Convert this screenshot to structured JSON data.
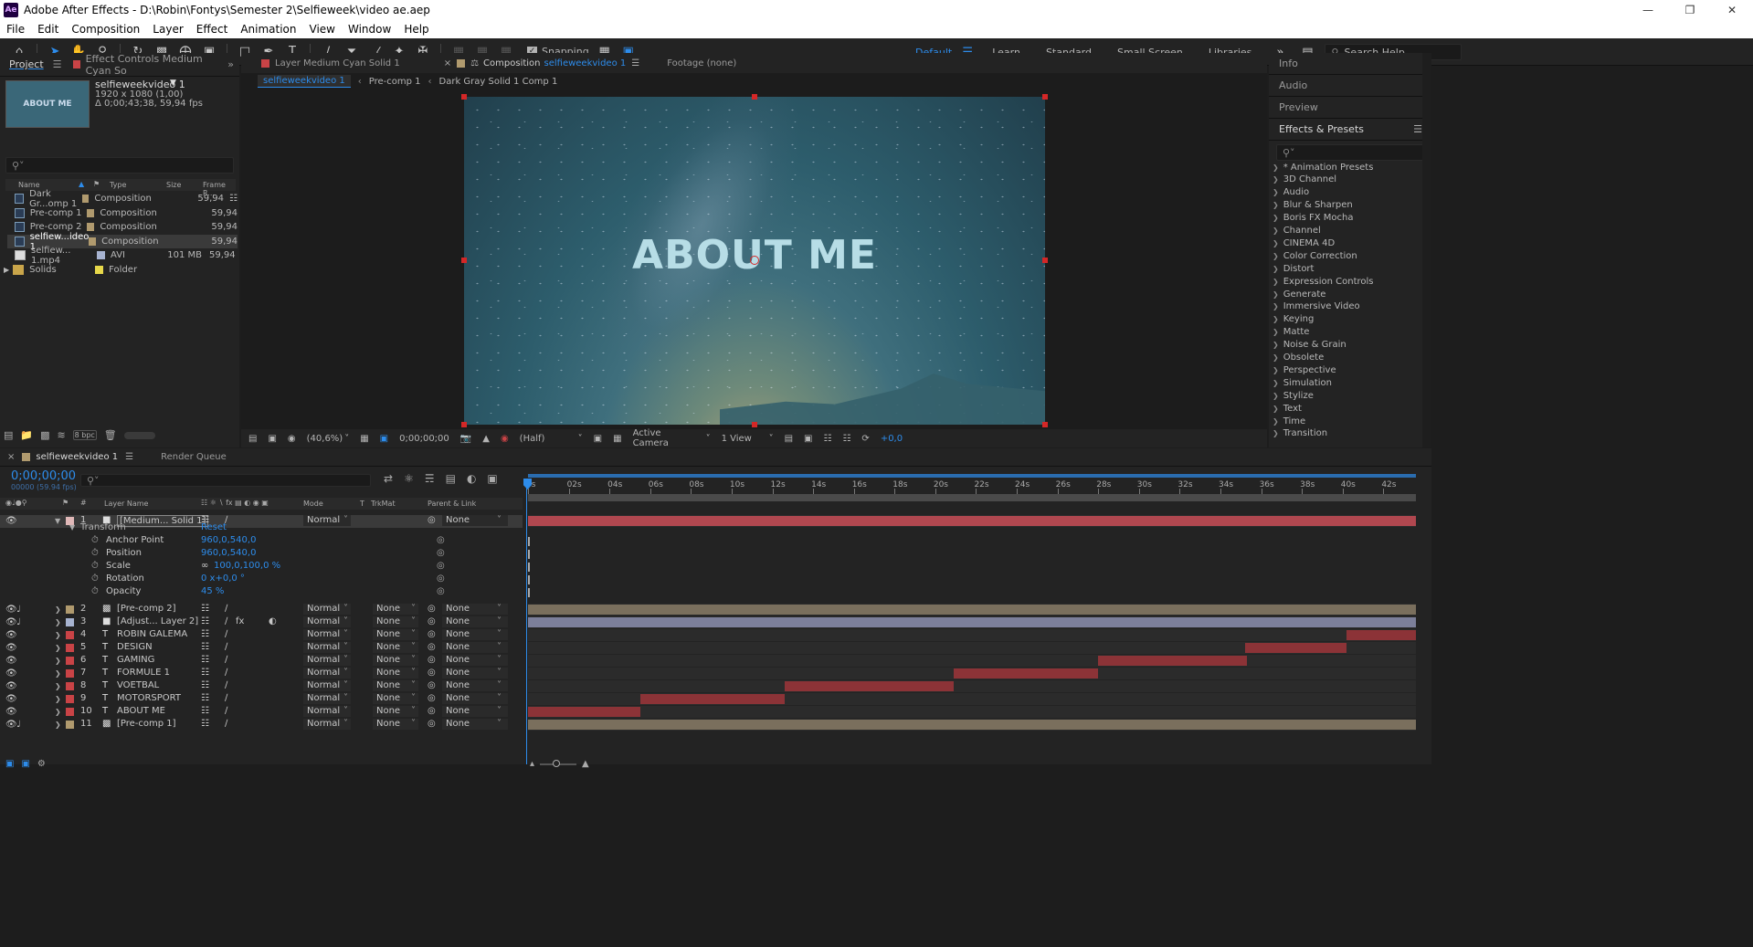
{
  "titlebar": {
    "icon": "Ae",
    "title": "Adobe After Effects - D:\\Robin\\Fontys\\Semester 2\\Selfieweek\\video ae.aep"
  },
  "menu": [
    "File",
    "Edit",
    "Composition",
    "Layer",
    "Effect",
    "Animation",
    "View",
    "Window",
    "Help"
  ],
  "toolbar": {
    "snapping_label": "Snapping",
    "workspaces": [
      "Default",
      "Learn",
      "Standard",
      "Small Screen",
      "Libraries"
    ],
    "active_workspace": "Default",
    "search_help": "Search Help"
  },
  "project": {
    "tab_project": "Project",
    "tab_effect_controls": "Effect Controls Medium Cyan So",
    "comp_name": "selfieweekvideo 1",
    "comp_res": "1920 x 1080 (1,00)",
    "comp_duration": "Δ 0;00;43;38, 59,94 fps",
    "thumb_text": "ABOUT ME",
    "columns": [
      "Name",
      "Type",
      "Size",
      "Frame R..."
    ],
    "items": [
      {
        "name": "Dark Gr...omp 1",
        "type": "Composition",
        "size": "",
        "fps": "59,94",
        "color": "#b09a6e"
      },
      {
        "name": "Pre-comp 1",
        "type": "Composition",
        "size": "",
        "fps": "59,94",
        "color": "#b09a6e"
      },
      {
        "name": "Pre-comp 2",
        "type": "Composition",
        "size": "",
        "fps": "59,94",
        "color": "#b09a6e"
      },
      {
        "name": "selfiew...ideo 1",
        "type": "Composition",
        "size": "",
        "fps": "59,94",
        "color": "#b09a6e"
      },
      {
        "name": "selfiew... 1.mp4",
        "type": "AVI",
        "size": "101 MB",
        "fps": "59,94",
        "color": "#a7b3d0"
      },
      {
        "name": "Solids",
        "type": "Folder",
        "size": "",
        "fps": "",
        "color": "#e7d84a"
      }
    ],
    "bpc": "8 bpc"
  },
  "viewer": {
    "tab_layer": "Layer  Medium Cyan Solid 1",
    "tab_comp_prefix": "Composition",
    "tab_comp_name": "selfieweekvideo 1",
    "tab_footage": "Footage  (none)",
    "breadcrumbs": [
      "selfieweekvideo 1",
      "Pre-comp 1",
      "Dark Gray Solid 1 Comp 1"
    ],
    "canvas_text": "ABOUT ME",
    "zoom": "(40,6%)",
    "timecode": "0;00;00;00",
    "resolution": "(Half)",
    "camera": "Active Camera",
    "views": "1 View",
    "exposure": "+0,0"
  },
  "right_panel": {
    "info": "Info",
    "audio": "Audio",
    "preview": "Preview",
    "effects_presets": "Effects & Presets",
    "categories": [
      "* Animation Presets",
      "3D Channel",
      "Audio",
      "Blur & Sharpen",
      "Boris FX Mocha",
      "Channel",
      "CINEMA 4D",
      "Color Correction",
      "Distort",
      "Expression Controls",
      "Generate",
      "Immersive Video",
      "Keying",
      "Matte",
      "Noise & Grain",
      "Obsolete",
      "Perspective",
      "Simulation",
      "Stylize",
      "Text",
      "Time",
      "Transition"
    ]
  },
  "timeline": {
    "tab_comp": "selfieweekvideo 1",
    "tab_render": "Render Queue",
    "timecode": "0;00;00;00",
    "frames": "00000 (59.94 fps)",
    "headers": {
      "layer_name": "Layer Name",
      "mode": "Mode",
      "t": "T",
      "trkmat": "TrkMat",
      "parent": "Parent & Link"
    },
    "ruler": [
      "0s",
      "02s",
      "04s",
      "06s",
      "08s",
      "10s",
      "12s",
      "14s",
      "16s",
      "18s",
      "20s",
      "22s",
      "24s",
      "26s",
      "28s",
      "30s",
      "32s",
      "34s",
      "36s",
      "38s",
      "40s",
      "42s"
    ],
    "transform": {
      "label": "Transform",
      "reset": "Reset",
      "props": [
        {
          "name": "Anchor Point",
          "value": "960,0,540,0"
        },
        {
          "name": "Position",
          "value": "960,0,540,0"
        },
        {
          "name": "Scale",
          "value": "100,0,100,0 %"
        },
        {
          "name": "Rotation",
          "value": "0 x+0,0 °"
        },
        {
          "name": "Opacity",
          "value": "45 %"
        }
      ]
    },
    "layers": [
      {
        "num": "1",
        "name": "[Medium... Solid 1]",
        "type": "solid",
        "mode": "Normal",
        "trkmat": "",
        "parent": "None",
        "color": "#e0b8b8",
        "bar_color": "#b0474f",
        "start": 0,
        "end": 43.6
      },
      {
        "num": "2",
        "name": "[Pre-comp 2]",
        "type": "comp",
        "mode": "Normal",
        "trkmat": "None",
        "parent": "None",
        "color": "#b09a6e",
        "bar_color": "#7a6f5d",
        "start": 0,
        "end": 43.6
      },
      {
        "num": "3",
        "name": "[Adjust... Layer 2]",
        "type": "adjust",
        "mode": "Normal",
        "trkmat": "None",
        "parent": "None",
        "color": "#a7b3d0",
        "bar_color": "#7c7f9a",
        "start": 0,
        "end": 43.6
      },
      {
        "num": "4",
        "name": "ROBIN GALEMA",
        "type": "text",
        "mode": "Normal",
        "trkmat": "None",
        "parent": "None",
        "color": "#c94346",
        "bar_color": "#8c3337",
        "start": 40.2,
        "end": 43.6
      },
      {
        "num": "5",
        "name": "DESIGN",
        "type": "text",
        "mode": "Normal",
        "trkmat": "None",
        "parent": "None",
        "color": "#c94346",
        "bar_color": "#8c3337",
        "start": 35.2,
        "end": 40.2
      },
      {
        "num": "6",
        "name": "GAMING",
        "type": "text",
        "mode": "Normal",
        "trkmat": "None",
        "parent": "None",
        "color": "#c94346",
        "bar_color": "#8c3337",
        "start": 28.0,
        "end": 35.3
      },
      {
        "num": "7",
        "name": "FORMULE 1",
        "type": "text",
        "mode": "Normal",
        "trkmat": "None",
        "parent": "None",
        "color": "#c94346",
        "bar_color": "#8c3337",
        "start": 20.9,
        "end": 28.0
      },
      {
        "num": "8",
        "name": "VOETBAL",
        "type": "text",
        "mode": "Normal",
        "trkmat": "None",
        "parent": "None",
        "color": "#c94346",
        "bar_color": "#8c3337",
        "start": 12.6,
        "end": 20.9
      },
      {
        "num": "9",
        "name": "MOTORSPORT",
        "type": "text",
        "mode": "Normal",
        "trkmat": "None",
        "parent": "None",
        "color": "#c94346",
        "bar_color": "#8c3337",
        "start": 5.5,
        "end": 12.6
      },
      {
        "num": "10",
        "name": "ABOUT ME",
        "type": "text",
        "mode": "Normal",
        "trkmat": "None",
        "parent": "None",
        "color": "#c94346",
        "bar_color": "#8c3337",
        "start": 0,
        "end": 5.5
      },
      {
        "num": "11",
        "name": "[Pre-comp 1]",
        "type": "comp",
        "mode": "Normal",
        "trkmat": "None",
        "parent": "None",
        "color": "#b09a6e",
        "bar_color": "#7a6f5d",
        "start": 0,
        "end": 43.6
      }
    ]
  },
  "colors": {
    "accent": "#2d8ceb",
    "panel": "#232323",
    "handle": "#d42727"
  }
}
